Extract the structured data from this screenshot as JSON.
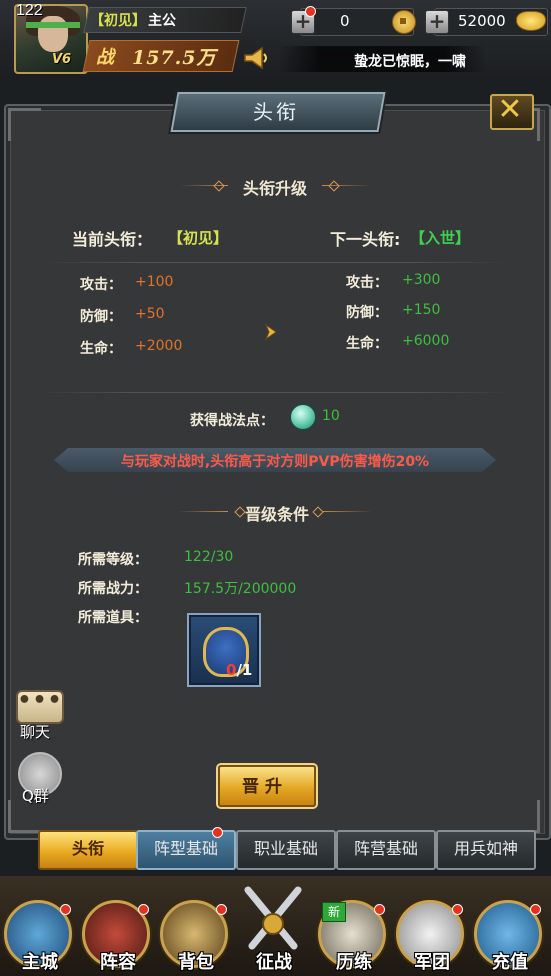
{
  "header": {
    "level": "122",
    "vip": "V6",
    "rank_tag": "【初见】",
    "player_name": "主公",
    "power_char": "战",
    "power_value": "157.5万",
    "resource_1": "0",
    "resource_2": "52000",
    "ticker": "蛰龙已惊眠，一啸"
  },
  "panel": {
    "title": "头衔",
    "section_upgrade": "头衔升级",
    "current_label": "当前头衔：",
    "current_value": "【初见】",
    "next_label": "下一头衔:",
    "next_value": "【入世】",
    "current_stats": [
      {
        "label": "攻击：",
        "value": "+100"
      },
      {
        "label": "防御：",
        "value": "+50"
      },
      {
        "label": "生命：",
        "value": "+2000"
      }
    ],
    "next_stats": [
      {
        "label": "攻击：",
        "value": "+300"
      },
      {
        "label": "防御：",
        "value": "+150"
      },
      {
        "label": "生命：",
        "value": "+6000"
      }
    ],
    "points_label": "获得战法点：",
    "points_value": "10",
    "banner": "与玩家对战时,头衔高于对方则PVP伤害增伤20%",
    "section_conditions": "晋级条件",
    "req_level_label": "所需等级：",
    "req_level_value": "122/30",
    "req_power_label": "所需战力：",
    "req_power_value": "157.5万/200000",
    "req_item_label": "所需道具：",
    "item_have": "0",
    "item_need": "/1",
    "upgrade_button": "晋升"
  },
  "side": {
    "chat": "聊天",
    "qq": "Q群"
  },
  "tabs": [
    "头衔",
    "阵型基础",
    "职业基础",
    "阵营基础",
    "用兵如神"
  ],
  "nav": [
    "主城",
    "阵容",
    "背包",
    "征战",
    "历练",
    "军团",
    "充值"
  ],
  "nav_badge_new": "新",
  "colors": {
    "orange_value": "#e2742a",
    "green_value": "#3fbf3f",
    "banner_red": "#ff5a48",
    "gold": "#e7a61d"
  }
}
